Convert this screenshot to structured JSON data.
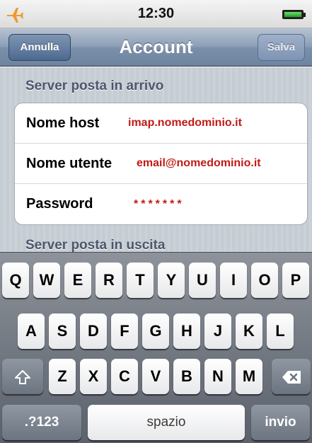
{
  "status_bar": {
    "time": "12:30"
  },
  "nav": {
    "cancel": "Annulla",
    "title": "Account",
    "save": "Salva"
  },
  "incoming": {
    "header": "Server posta in arrivo",
    "rows": [
      {
        "label": "Nome host",
        "value": "imap.nomedominio.it"
      },
      {
        "label": "Nome utente",
        "value": "email@nomedominio.it"
      },
      {
        "label": "Password",
        "value": "*******"
      }
    ]
  },
  "outgoing": {
    "header": "Server posta in uscita"
  },
  "keyboard": {
    "row1": [
      "Q",
      "W",
      "E",
      "R",
      "T",
      "Y",
      "U",
      "I",
      "O",
      "P"
    ],
    "row2": [
      "A",
      "S",
      "D",
      "F",
      "G",
      "H",
      "J",
      "K",
      "L"
    ],
    "row3": [
      "Z",
      "X",
      "C",
      "V",
      "B",
      "N",
      "M"
    ],
    "numbers": ".?123",
    "space": "spazio",
    "return": "invio"
  }
}
